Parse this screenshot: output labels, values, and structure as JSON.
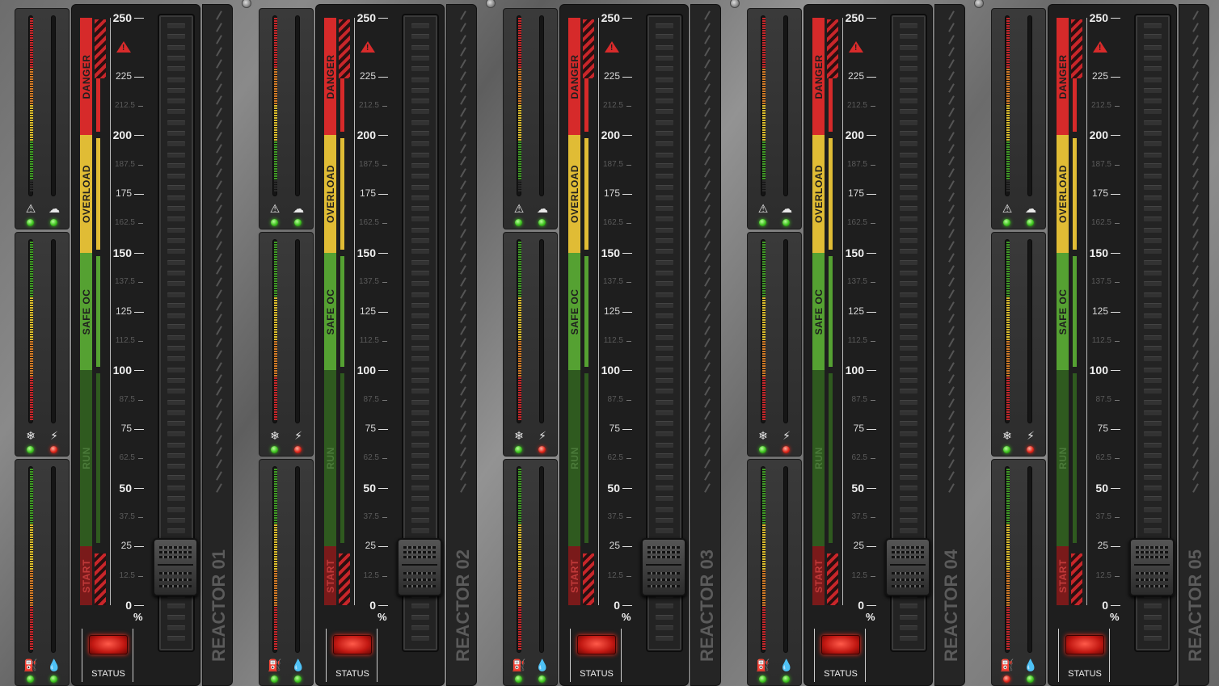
{
  "scale": {
    "unit_label": "%",
    "major_ticks": [
      "250",
      "225",
      "200",
      "175",
      "150",
      "125",
      "100",
      "75",
      "50",
      "25",
      "0"
    ],
    "minor_ticks": [
      "212.5",
      "187.5",
      "162.5",
      "137.5",
      "112.5",
      "87.5",
      "62.5",
      "37.5",
      "12.5"
    ],
    "zones": [
      {
        "label": "DANGER",
        "color": "#d62a2a",
        "from": 200,
        "to": 250
      },
      {
        "label": "OVERLOAD",
        "color": "#e0bc35",
        "from": 150,
        "to": 200
      },
      {
        "label": "SAFE OC",
        "color": "#55a132",
        "from": 100,
        "to": 150
      },
      {
        "label": "RUN",
        "color": "#2f5a1f",
        "from": 25,
        "to": 100
      },
      {
        "label": "START",
        "color": "#7a1a1a",
        "from": 0,
        "to": 25
      }
    ]
  },
  "status_label": "STATUS",
  "icons": {
    "gauge1": [
      "warning-icon",
      "cloud-icon"
    ],
    "gauge2": [
      "snowflake-icon",
      "bolt-icon"
    ],
    "gauge3": [
      "fuel-icon",
      "droplet-icon"
    ]
  },
  "reactors": [
    {
      "name": "REACTOR 01",
      "leds": [
        "green",
        "green",
        "green",
        "red",
        "green",
        "green"
      ],
      "setpoint_percent": 25
    },
    {
      "name": "REACTOR 02",
      "leds": [
        "green",
        "green",
        "green",
        "red",
        "green",
        "green"
      ],
      "setpoint_percent": 25
    },
    {
      "name": "REACTOR 03",
      "leds": [
        "green",
        "green",
        "green",
        "red",
        "green",
        "green"
      ],
      "setpoint_percent": 25
    },
    {
      "name": "REACTOR 04",
      "leds": [
        "green",
        "green",
        "green",
        "red",
        "green",
        "green"
      ],
      "setpoint_percent": 25
    },
    {
      "name": "REACTOR 05",
      "leds": [
        "green",
        "green",
        "green",
        "red",
        "red",
        "green"
      ],
      "setpoint_percent": 25
    }
  ],
  "colors": {
    "danger": "#d62a2a",
    "overload": "#e0bc35",
    "safe": "#55a132",
    "run": "#2f5a1f",
    "led_green": "#3ec21f",
    "led_red": "#e0271b"
  }
}
